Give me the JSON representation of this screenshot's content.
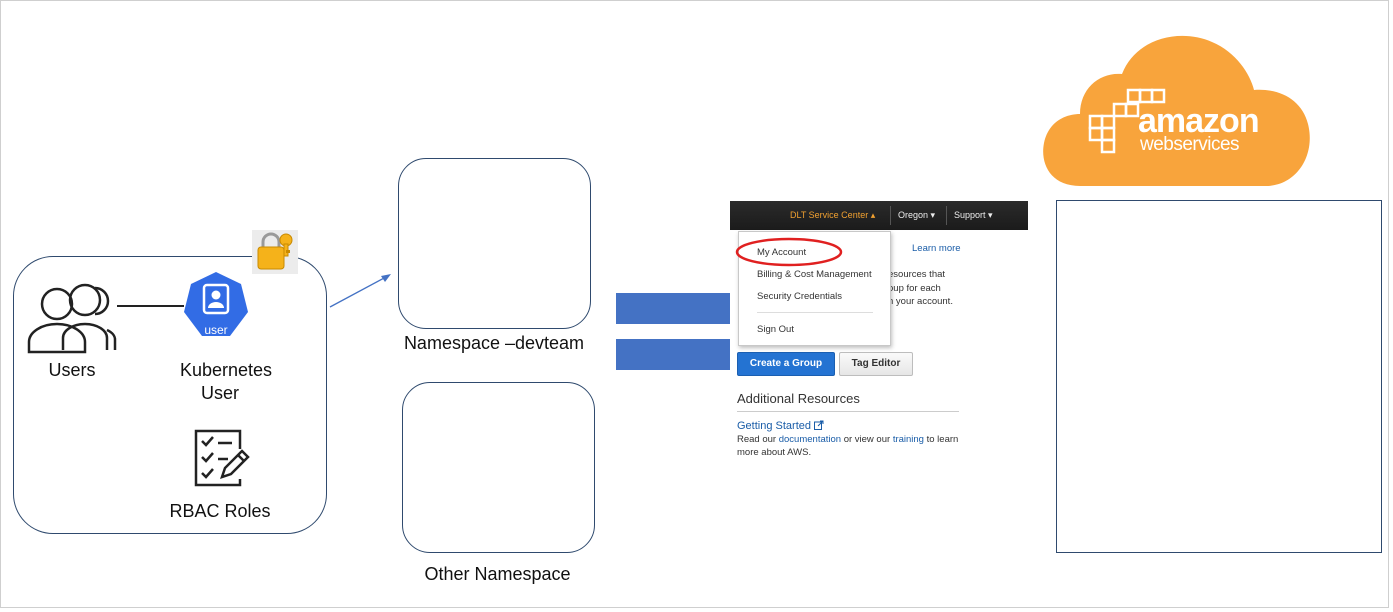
{
  "left_panel": {
    "users_label": "Users",
    "k8s_user_badge": "user",
    "k8s_user_label_line1": "Kubernetes",
    "k8s_user_label_line2": "User",
    "rbac_label": "RBAC Roles"
  },
  "namespaces": {
    "devteam_label": "Namespace –devteam",
    "other_label": "Other Namespace"
  },
  "aws_console": {
    "topbar": {
      "account_menu": "DLT Service Center",
      "region_menu": "Oregon",
      "support_menu": "Support"
    },
    "dropdown": {
      "items": [
        "My Account",
        "Billing & Cost Management",
        "Security Credentials",
        "Sign Out"
      ],
      "highlighted": "My Account"
    },
    "learn_more": "Learn more",
    "partial_text": [
      "esources that",
      "oup for each",
      "n your account."
    ],
    "create_group_button": "Create a Group",
    "tag_editor_button": "Tag Editor",
    "additional_resources_title": "Additional Resources",
    "getting_started_link": "Getting Started",
    "read_our": "Read our ",
    "documentation_link": "documentation",
    "or_view_our": " or view our ",
    "training_link": "training",
    "to_learn": " to learn",
    "more_about": "more about AWS."
  },
  "aws_logo": {
    "line1": "amazon",
    "line2": "webservices"
  },
  "colors": {
    "accent_blue": "#4472c4",
    "k8s_blue": "#326ce5",
    "aws_orange": "#f8a43c",
    "highlight_red": "#e02020"
  }
}
